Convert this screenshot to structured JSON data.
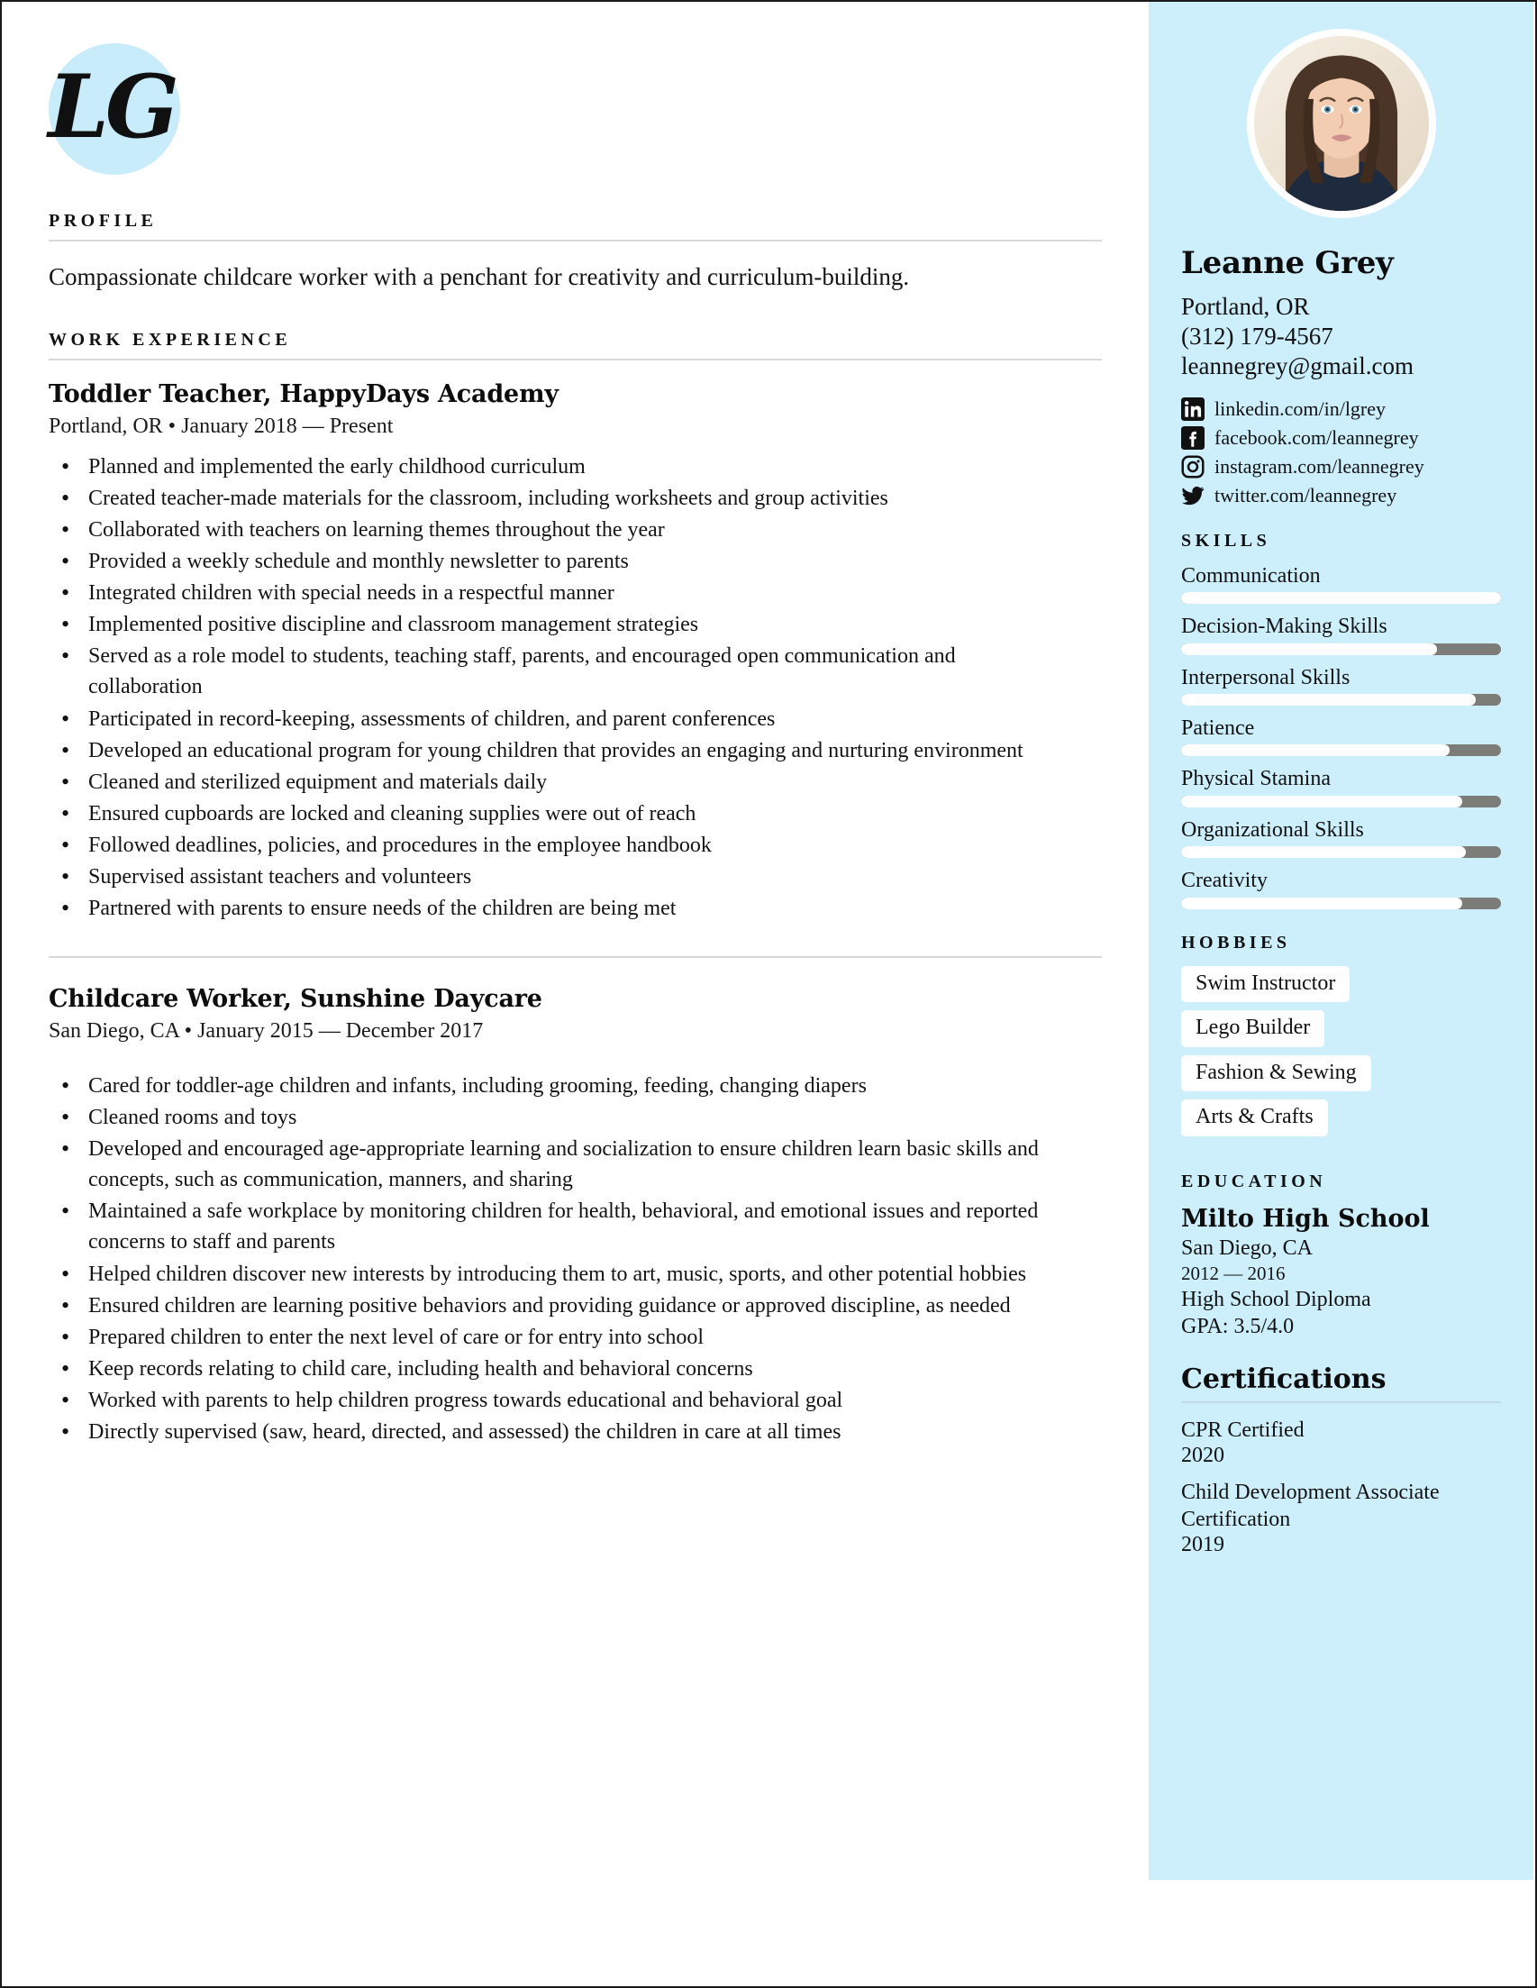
{
  "monogram": {
    "initials": "LG",
    "bg_color": "#c8ecfa"
  },
  "theme": {
    "sidebar_bg": "#cdeffc",
    "bar_track": "#7c7c78",
    "bar_fill": "#ffffff",
    "rule": "#d9d9d9"
  },
  "main": {
    "profile": {
      "heading": "PROFILE",
      "text": "Compassionate childcare worker with a penchant for creativity and curriculum-building."
    },
    "work": {
      "heading": "WORK EXPERIENCE",
      "jobs": [
        {
          "title": "Toddler Teacher, HappyDays Academy",
          "meta": "Portland, OR • January 2018 — Present",
          "bullets": [
            "Planned and implemented the early childhood curriculum",
            "Created teacher-made materials for the classroom, including worksheets and group activities",
            "Collaborated with teachers on learning themes throughout the year",
            "Provided a weekly schedule and monthly newsletter to parents",
            "Integrated children with special needs in a respectful manner",
            "Implemented positive discipline and classroom management strategies",
            "Served as a role model to students, teaching staff, parents, and encouraged open communication and collaboration",
            "Participated in record-keeping, assessments of children, and parent conferences",
            "Developed an educational program for young children that provides an engaging and nurturing environment",
            "Cleaned and sterilized equipment and materials daily",
            "Ensured cupboards are locked and cleaning supplies were out of reach",
            "Followed deadlines, policies, and procedures in the employee handbook",
            "Supervised assistant teachers and volunteers",
            "Partnered with parents to ensure needs of the children are being met"
          ]
        },
        {
          "title": "Childcare Worker, Sunshine Daycare",
          "meta": "San Diego, CA • January 2015 — December 2017",
          "bullets": [
            "Cared for toddler-age children and infants, including grooming, feeding, changing diapers",
            "Cleaned rooms and toys",
            "Developed and encouraged age-appropriate learning and socialization to ensure children learn basic skills and concepts, such as communication, manners, and sharing",
            "Maintained a safe workplace by monitoring children for health, behavioral, and emotional issues and reported concerns to staff and parents",
            "Helped children discover new interests by introducing them to art, music, sports, and other potential hobbies",
            "Ensured children are learning positive behaviors and providing guidance or approved discipline, as needed",
            "Prepared children to enter the next level of care or for entry into school",
            "Keep records relating to child care, including health and behavioral concerns",
            "Worked with parents to help children progress towards educational and behavioral goal",
            "Directly supervised (saw, heard, directed, and assessed) the children in care at all times"
          ]
        }
      ]
    }
  },
  "sidebar": {
    "name": "Leanne Grey",
    "location": "Portland, OR",
    "phone": "(312) 179-4567",
    "email": "leannegrey@gmail.com",
    "social": [
      {
        "icon": "linkedin-icon",
        "text": "linkedin.com/in/lgrey"
      },
      {
        "icon": "facebook-icon",
        "text": "facebook.com/leannegrey"
      },
      {
        "icon": "instagram-icon",
        "text": "instagram.com/leannegrey"
      },
      {
        "icon": "twitter-icon",
        "text": "twitter.com/leannegrey"
      }
    ],
    "skills": {
      "heading": "SKILLS",
      "items": [
        {
          "label": "Communication",
          "level": 100
        },
        {
          "label": "Decision-Making Skills",
          "level": 80
        },
        {
          "label": "Interpersonal Skills",
          "level": 92
        },
        {
          "label": "Patience",
          "level": 84
        },
        {
          "label": "Physical Stamina",
          "level": 88
        },
        {
          "label": "Organizational Skills",
          "level": 89
        },
        {
          "label": "Creativity",
          "level": 88
        }
      ]
    },
    "hobbies": {
      "heading": "HOBBIES",
      "items": [
        "Swim Instructor",
        "Lego Builder",
        "Fashion & Sewing",
        "Arts & Crafts"
      ]
    },
    "education": {
      "heading": "EDUCATION",
      "school": "Milto High School",
      "location": "San Diego, CA",
      "years": "2012 — 2016",
      "degree": "High School Diploma",
      "gpa": "GPA: 3.5/4.0"
    },
    "certifications": {
      "heading": "Certifications",
      "items": [
        {
          "name": "CPR Certified",
          "year": "2020"
        },
        {
          "name": "Child Development Associate Certification",
          "year": "2019"
        }
      ]
    }
  }
}
